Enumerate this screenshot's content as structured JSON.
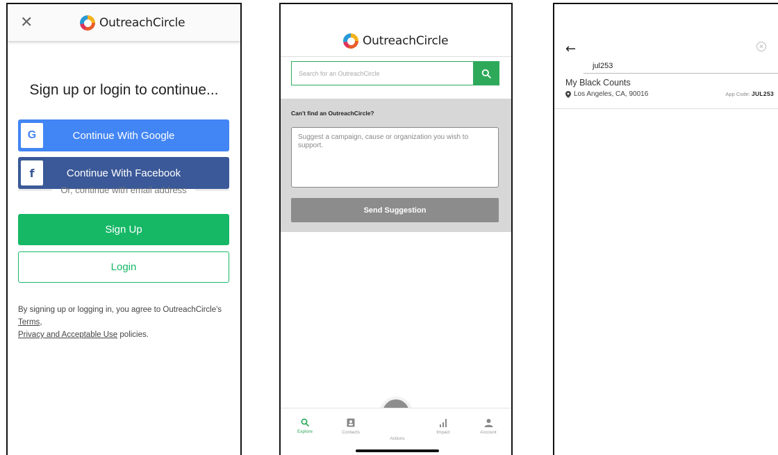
{
  "brand": {
    "name": "OutreachCircle"
  },
  "login": {
    "close_icon": "close-icon",
    "title": "Sign up or login to continue...",
    "google_label": "Continue With Google",
    "google_icon_letter": "G",
    "facebook_label": "Continue With Facebook",
    "facebook_icon_letter": "f",
    "divider_text": "Or, continue with email address",
    "signup_label": "Sign Up",
    "login_label": "Login",
    "legal_prefix": "By signing up or logging in, you agree to OutreachCircle's ",
    "legal_terms": "Terms",
    "legal_comma": ",",
    "legal_privacy": "Privacy and Acceptable Use",
    "legal_suffix": " policies."
  },
  "explore": {
    "search_placeholder": "Search for an OutreachCircle",
    "suggest_title": "Can't find an OutreachCircle?",
    "suggest_placeholder": "Suggest a campaign, cause or organization you wish to support.",
    "send_label": "Send Suggestion",
    "tabs": [
      {
        "label": "Explore",
        "icon": "search-icon",
        "active": true
      },
      {
        "label": "Contacts",
        "icon": "contacts-icon",
        "active": false
      },
      {
        "label": "Actions",
        "icon": "home-icon",
        "active": false
      },
      {
        "label": "Impact",
        "icon": "bar-chart-icon",
        "active": false
      },
      {
        "label": "Account",
        "icon": "person-icon",
        "active": false
      }
    ]
  },
  "search_results": {
    "query": "jul253",
    "results": [
      {
        "name": "My Black Counts",
        "location": "Los Angeles, CA, 90016",
        "code_label": "App Code:",
        "code": "JUL253"
      }
    ]
  },
  "colors": {
    "green": "#16b866",
    "google_blue": "#4285f4",
    "facebook_blue": "#3b5998",
    "gray_button": "#8c8c8c"
  }
}
